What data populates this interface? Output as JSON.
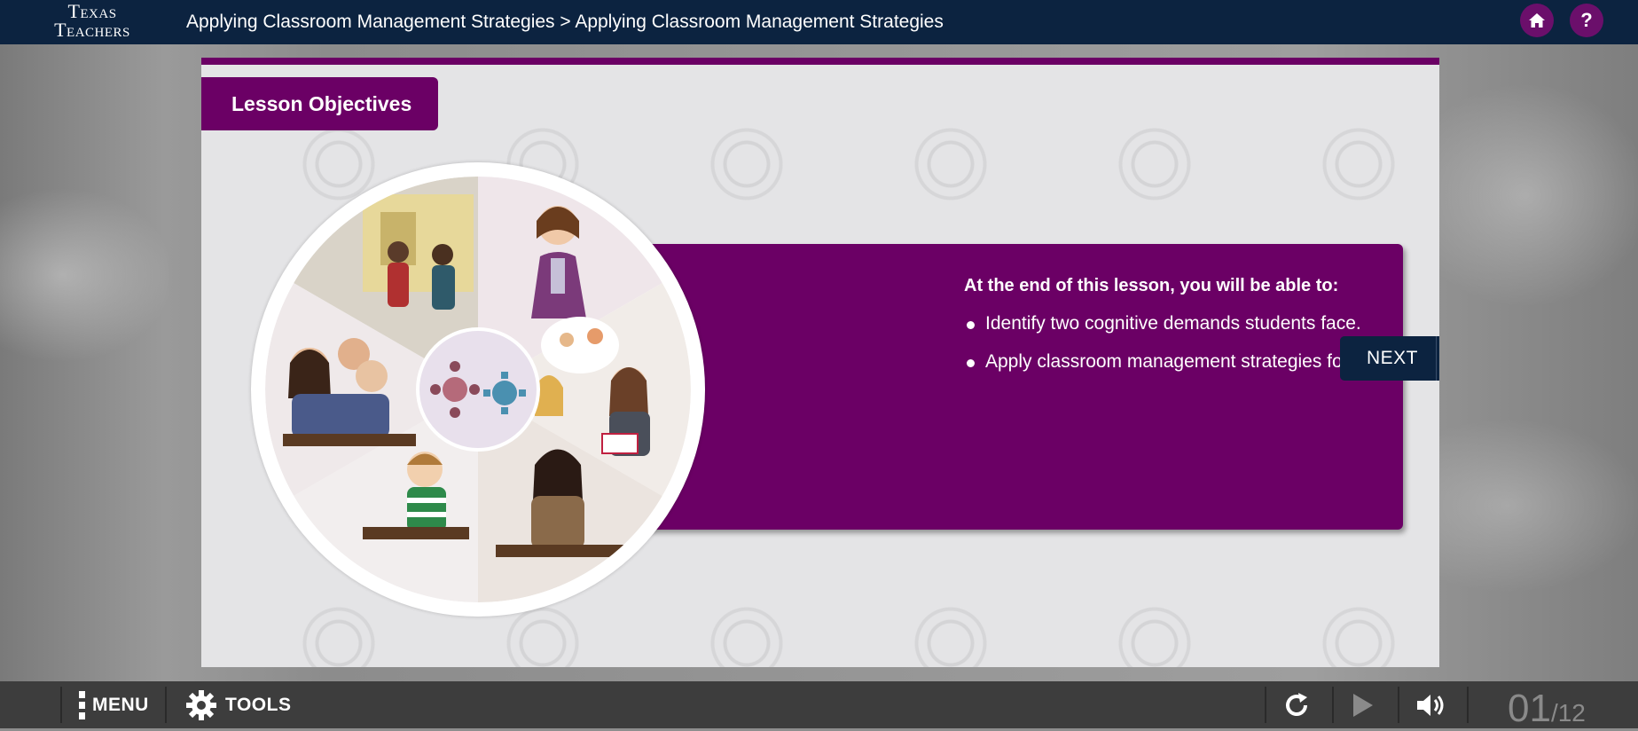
{
  "header": {
    "logo_line1": "Texas",
    "logo_line2": "Teachers",
    "breadcrumb": "Applying Classroom Management Strategies > Applying Classroom Management Strategies",
    "home_icon": "home-icon",
    "help_label": "?"
  },
  "slide": {
    "tab_label": "Lesson Objectives",
    "objectives_heading": "At the end of this lesson, you will be able to:",
    "objectives": [
      "Identify two cognitive demands students face.",
      "Apply classroom management strategies for a given scenario."
    ],
    "next_label": "NEXT"
  },
  "toolbar": {
    "menu_label": "MENU",
    "tools_label": "TOOLS",
    "page_current": "01",
    "page_total": "/12"
  },
  "colors": {
    "navy": "#0c2340",
    "purple": "#6b0065",
    "toolbar_bg": "#3d3d3d"
  }
}
